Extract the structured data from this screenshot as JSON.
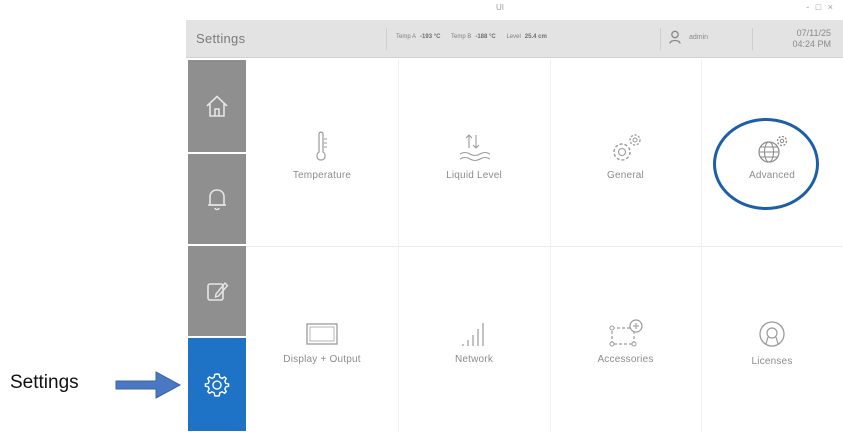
{
  "window": {
    "title": "UI",
    "controls": "- □ ×"
  },
  "header": {
    "title": "Settings",
    "readings": [
      {
        "label": "Temp A",
        "value": "-193 °C"
      },
      {
        "label": "Temp B",
        "value": "-188 °C"
      },
      {
        "label": "Level",
        "value": "25.4 cm"
      }
    ],
    "user": "admin",
    "date": "07/11/25",
    "time": "04:24 PM"
  },
  "sidebar": {
    "items": [
      {
        "name": "home",
        "icon": "home-icon"
      },
      {
        "name": "alarms",
        "icon": "bell-icon"
      },
      {
        "name": "log",
        "icon": "edit-icon"
      },
      {
        "name": "settings",
        "icon": "gear-icon",
        "active": true
      }
    ]
  },
  "tiles": [
    {
      "label": "Temperature",
      "icon": "thermometer-icon"
    },
    {
      "label": "Liquid Level",
      "icon": "liquid-level-icon"
    },
    {
      "label": "General",
      "icon": "gears-icon"
    },
    {
      "label": "Advanced",
      "icon": "globe-gear-icon"
    },
    {
      "label": "Display + Output",
      "icon": "monitor-icon"
    },
    {
      "label": "Network",
      "icon": "signal-bars-icon"
    },
    {
      "label": "Accessories",
      "icon": "accessories-icon"
    },
    {
      "label": "Licenses",
      "icon": "license-icon"
    }
  ],
  "annotation": {
    "label": "Settings",
    "highlight": "Advanced"
  },
  "colors": {
    "accent": "#1f73c6",
    "sidebar": "#8f8f8f",
    "header": "#e3e3e3",
    "ring": "#1d5ea8"
  }
}
